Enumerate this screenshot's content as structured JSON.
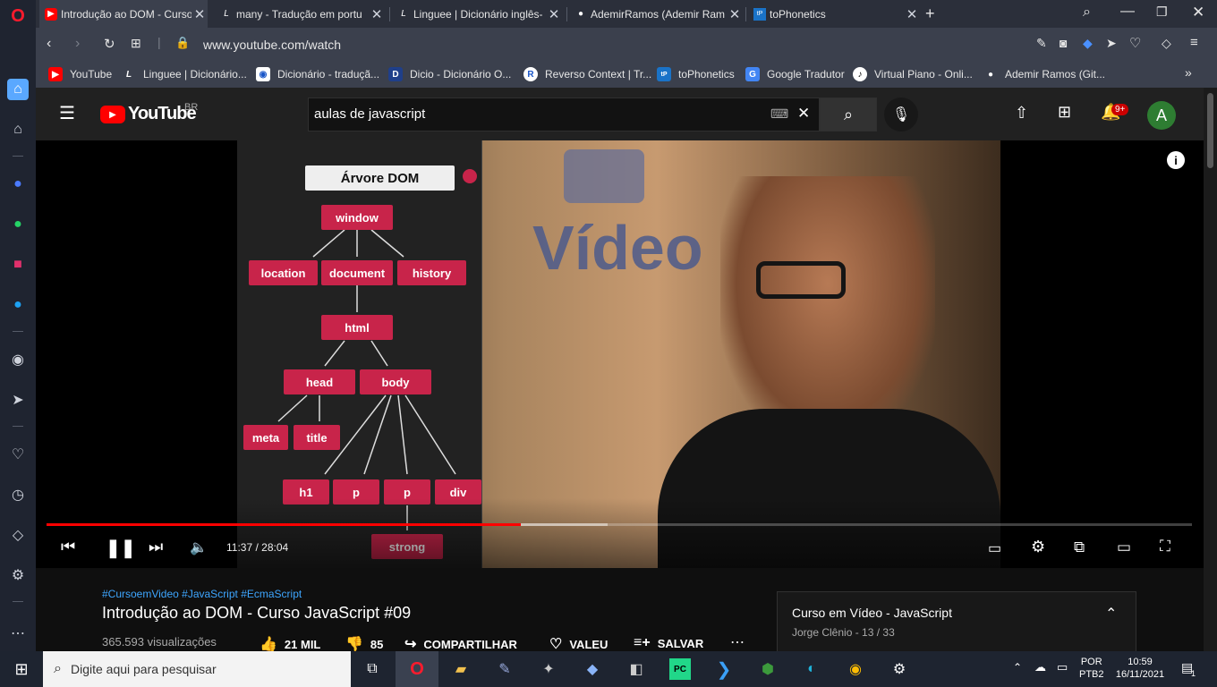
{
  "tabs": [
    {
      "title": "Introdução ao DOM - Curso",
      "active": true
    },
    {
      "title": "many - Tradução em portu",
      "active": false
    },
    {
      "title": "Linguee | Dicionário inglês-",
      "active": false
    },
    {
      "title": "AdemirRamos (Ademir Ram",
      "active": false
    },
    {
      "title": "toPhonetics",
      "active": false
    }
  ],
  "address": {
    "url": "www.youtube.com/watch"
  },
  "bookmarks": [
    "YouTube",
    "Linguee | Dicionário...",
    "Dicionário - traduçã...",
    "Dicio - Dicionário O...",
    "Reverso Context | Tr...",
    "toPhonetics",
    "Google Tradutor",
    "Virtual Piano - Onli...",
    "Ademir Ramos (Git..."
  ],
  "youtube": {
    "logo_text": "YouTube",
    "region": "BR",
    "search_value": "aulas de javascript",
    "notification_count": "9+",
    "avatar_letter": "A"
  },
  "video": {
    "dom_title": "Árvore DOM",
    "nodes": {
      "window": "window",
      "location": "location",
      "document": "document",
      "history": "history",
      "html": "html",
      "head": "head",
      "body": "body",
      "meta": "meta",
      "title": "title",
      "h1": "h1",
      "p1": "p",
      "p2": "p",
      "div": "div",
      "strong": "strong"
    },
    "bg_brand": "Vídeo",
    "time_current": "11:37",
    "time_total": "28:04",
    "progress": 0.414,
    "buffered": 0.49
  },
  "details": {
    "hashtags": "#CursoemVideo #JavaScript #EcmaScript",
    "title": "Introdução ao DOM - Curso JavaScript #09",
    "views": "365.593 visualizações",
    "likes": "21 MIL",
    "dislikes": "85",
    "share": "COMPARTILHAR",
    "thanks": "VALEU",
    "save": "SALVAR"
  },
  "playlist": {
    "title": "Curso em Vídeo - JavaScript",
    "channel": "Jorge Clênio",
    "position": "13 / 33"
  },
  "taskbar": {
    "search_placeholder": "Digite aqui para pesquisar",
    "lang1": "POR",
    "lang2": "PTB2",
    "time": "10:59",
    "date": "16/11/2021",
    "notif": "1"
  }
}
